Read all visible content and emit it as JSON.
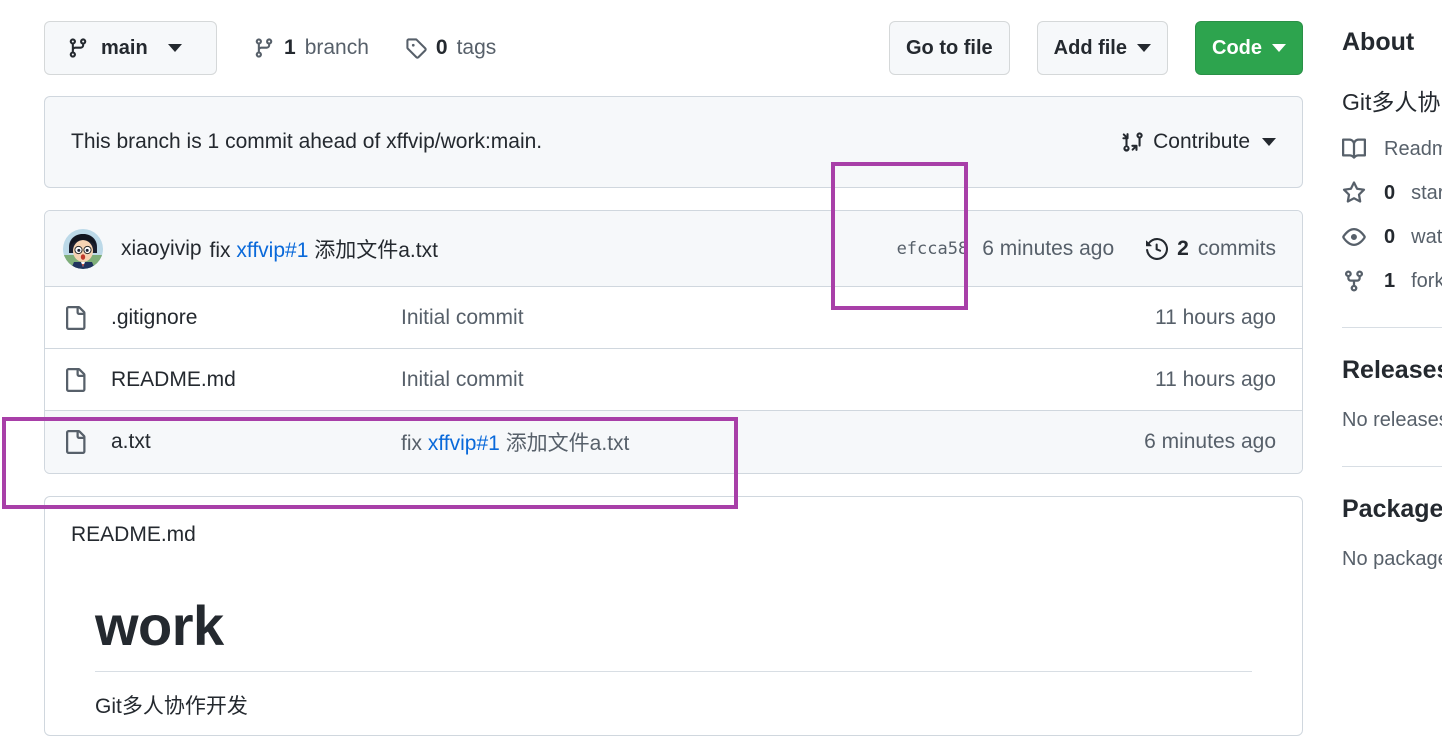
{
  "toolbar": {
    "branch_button": {
      "label": "main",
      "icon": "branch-icon"
    },
    "branches": {
      "count": "1",
      "label": "branch",
      "icon": "branch-icon"
    },
    "tags": {
      "count": "0",
      "label": "tags",
      "icon": "tag-icon"
    },
    "go_to_file": "Go to file",
    "add_file": "Add file",
    "code": "Code"
  },
  "notice": {
    "text": "This branch is 1 commit ahead of xffvip/work:main.",
    "contribute": "Contribute",
    "contribute_icon": "pull-request-icon"
  },
  "latest_commit": {
    "author": "xiaoyivip",
    "message_prefix": "fix",
    "message_link": "xffvip#1",
    "message_suffix": "添加文件a.txt",
    "hash": "efcca58",
    "date": "6 minutes ago",
    "commits_count": "2",
    "commits_label": "commits",
    "commits_icon": "history-icon",
    "avatar": "avatar-xiaoyivip"
  },
  "files": [
    {
      "icon": "file-icon",
      "name": ".gitignore",
      "message": "Initial commit",
      "message_link": "",
      "message_prefix": "Initial commit",
      "message_suffix": "",
      "time": "11 hours ago",
      "hovered": false
    },
    {
      "icon": "file-icon",
      "name": "README.md",
      "message": "Initial commit",
      "message_link": "",
      "message_prefix": "Initial commit",
      "message_suffix": "",
      "time": "11 hours ago",
      "hovered": false
    },
    {
      "icon": "file-icon",
      "name": "a.txt",
      "message": "fix xffvip#1 添加文件a.txt",
      "message_link": "xffvip#1",
      "message_prefix": "fix",
      "message_suffix": "添加文件a.txt",
      "time": "6 minutes ago",
      "hovered": true
    }
  ],
  "readme": {
    "title": "README.md",
    "heading": "work",
    "paragraph": "Git多人协作开发"
  },
  "sidebar": {
    "about_heading": "About",
    "description": "Git多人协",
    "items": [
      {
        "icon": "book-icon",
        "count": "",
        "label": "Readme"
      },
      {
        "icon": "star-icon",
        "count": "0",
        "label": "stars"
      },
      {
        "icon": "eye-icon",
        "count": "0",
        "label": "watching"
      },
      {
        "icon": "fork-icon",
        "count": "1",
        "label": "forks"
      }
    ],
    "releases_heading": "Releases",
    "releases_empty": "No releases",
    "packages_heading": "Packages",
    "packages_empty": "No packages"
  },
  "annotations": {
    "color": "#a83fa8",
    "boxes": [
      {
        "name": "commit-hash-highlight"
      },
      {
        "name": "file-row-highlight"
      }
    ]
  }
}
